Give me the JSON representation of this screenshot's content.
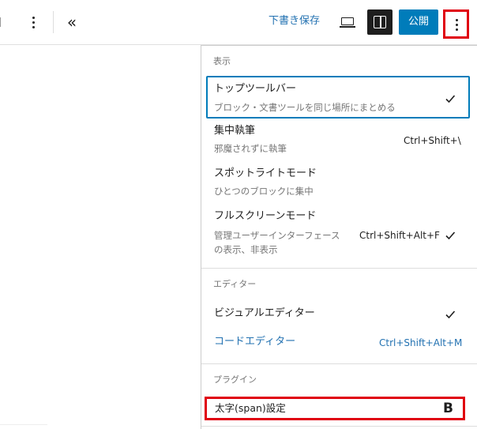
{
  "toolbar": {
    "save_draft_label": "下書き保存",
    "publish_label": "公開",
    "collapse_glyph": "«",
    "icons": {
      "preview": "laptop-icon",
      "settings": "sidebar-panel-icon",
      "options": "vertical-ellipsis-icon"
    },
    "accent_color": "#007cba",
    "highlight_color": "#e0000f"
  },
  "menu": {
    "view_group": {
      "label": "表示",
      "items": [
        {
          "title": "トップツールバー",
          "description": "ブロック・文書ツールを同じ場所にまとめる",
          "shortcut": "",
          "checked": true,
          "selected": true
        },
        {
          "title": "集中執筆",
          "description": "邪魔されずに執筆",
          "shortcut": "Ctrl+Shift+\\",
          "checked": false
        },
        {
          "title": "スポットライトモード",
          "description": "ひとつのブロックに集中",
          "shortcut": "",
          "checked": false
        },
        {
          "title": "フルスクリーンモード",
          "description": "管理ユーザーインターフェースの表示、非表示",
          "shortcut": "Ctrl+Shift+Alt+F",
          "checked": true
        }
      ]
    },
    "editor_group": {
      "label": "エディター",
      "items": [
        {
          "title": "ビジュアルエディター",
          "shortcut": "",
          "checked": true
        },
        {
          "title": "コードエディター",
          "shortcut": "Ctrl+Shift+Alt+M",
          "checked": false
        }
      ]
    },
    "plugin_group": {
      "label": "プラグイン",
      "items": [
        {
          "title": "太字(span)設定",
          "glyph": "B"
        }
      ]
    }
  }
}
